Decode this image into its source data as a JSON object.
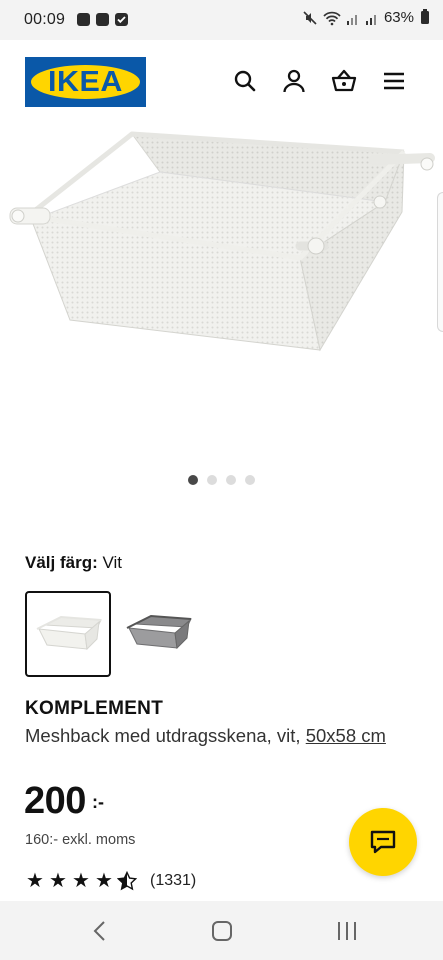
{
  "status_bar": {
    "time": "00:09",
    "battery": "63%",
    "icons": [
      "mute-icon",
      "wifi-icon",
      "signal-icon",
      "signal-icon",
      "battery-icon"
    ]
  },
  "header": {
    "logo_text": "IKEA",
    "brand_colors": {
      "blue": "#0a58a8",
      "yellow": "#ffd500"
    },
    "icons": [
      "search-icon",
      "profile-icon",
      "basket-icon",
      "menu-icon"
    ]
  },
  "gallery": {
    "image_count": 4,
    "active_index": 0
  },
  "color_selector": {
    "label": "Välj färg:",
    "selected": "Vit",
    "options": [
      "white-swatch",
      "grey-swatch"
    ]
  },
  "product": {
    "name": "KOMPLEMENT",
    "description": "Meshback med utdragsskena, vit,",
    "size_link": "50x58 cm",
    "price": "200",
    "price_suffix": ":-",
    "price_ex_vat": "160:- exkl. moms",
    "rating_stars": 4.5,
    "review_count": "(1331)"
  },
  "nav": {
    "buttons": [
      "back-icon",
      "home-icon",
      "recents-icon"
    ]
  }
}
